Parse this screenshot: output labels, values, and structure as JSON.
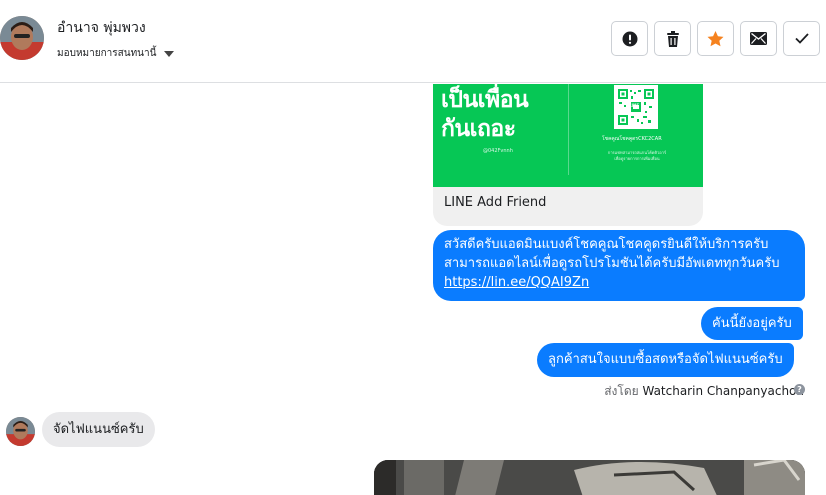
{
  "header": {
    "contact_name": "อำนาจ พุ่มพวง",
    "assign_label": "มอบหมายการสนทนานี้"
  },
  "toolbar": {
    "buttons": [
      {
        "name": "spam-report-button",
        "icon": "alert-circle-icon"
      },
      {
        "name": "delete-button",
        "icon": "trash-icon"
      },
      {
        "name": "star-button",
        "icon": "star-icon",
        "color": "#f5821f"
      },
      {
        "name": "mark-unread-button",
        "icon": "envelope-icon"
      },
      {
        "name": "mark-done-button",
        "icon": "check-icon"
      }
    ]
  },
  "conversation": {
    "line_card": {
      "headline_1": "เป็นเพื่อน",
      "headline_2": "กันเถอะ",
      "line_id": "@042Fvnnh",
      "qr_label": "LINE",
      "qr_caption": "โชคคูณโชคคูดรCKC2CAR",
      "qr_small": "การแชทสามารถสแกนโค้ดคิวอาร์เพื่อดูรายการการเพิ่มเพื่อน",
      "title": "LINE Add Friend"
    },
    "outgoing": {
      "line1": "สวัสดีครับแอดมินแบงค์โชคคูณโชคคูดรยินดีให้บริการครับ",
      "line2": "สามารถแอดไลน์เพื่อดูรถโปรโมชันได้ครับมีอัพเดททุกวันครับ",
      "link": "https://lin.ee/QQAI9Zn",
      "msg2": "คันนี้ยังอยู่ครับ",
      "msg3": "ลูกค้าสนใจแบบซื้อสดหรือจัดไฟแนนซ์ครับ"
    },
    "sent_by": {
      "prefix": "ส่งโดย",
      "sender": "Watcharin Chanpanyachon",
      "help_glyph": "?"
    },
    "incoming": {
      "msg1": "จัดไฟแนนซ์ครับ"
    }
  },
  "colors": {
    "outgoing_bubble": "#0a7cff",
    "incoming_bubble": "#e9e9eb",
    "line_green": "#06c755",
    "star": "#f5821f"
  }
}
